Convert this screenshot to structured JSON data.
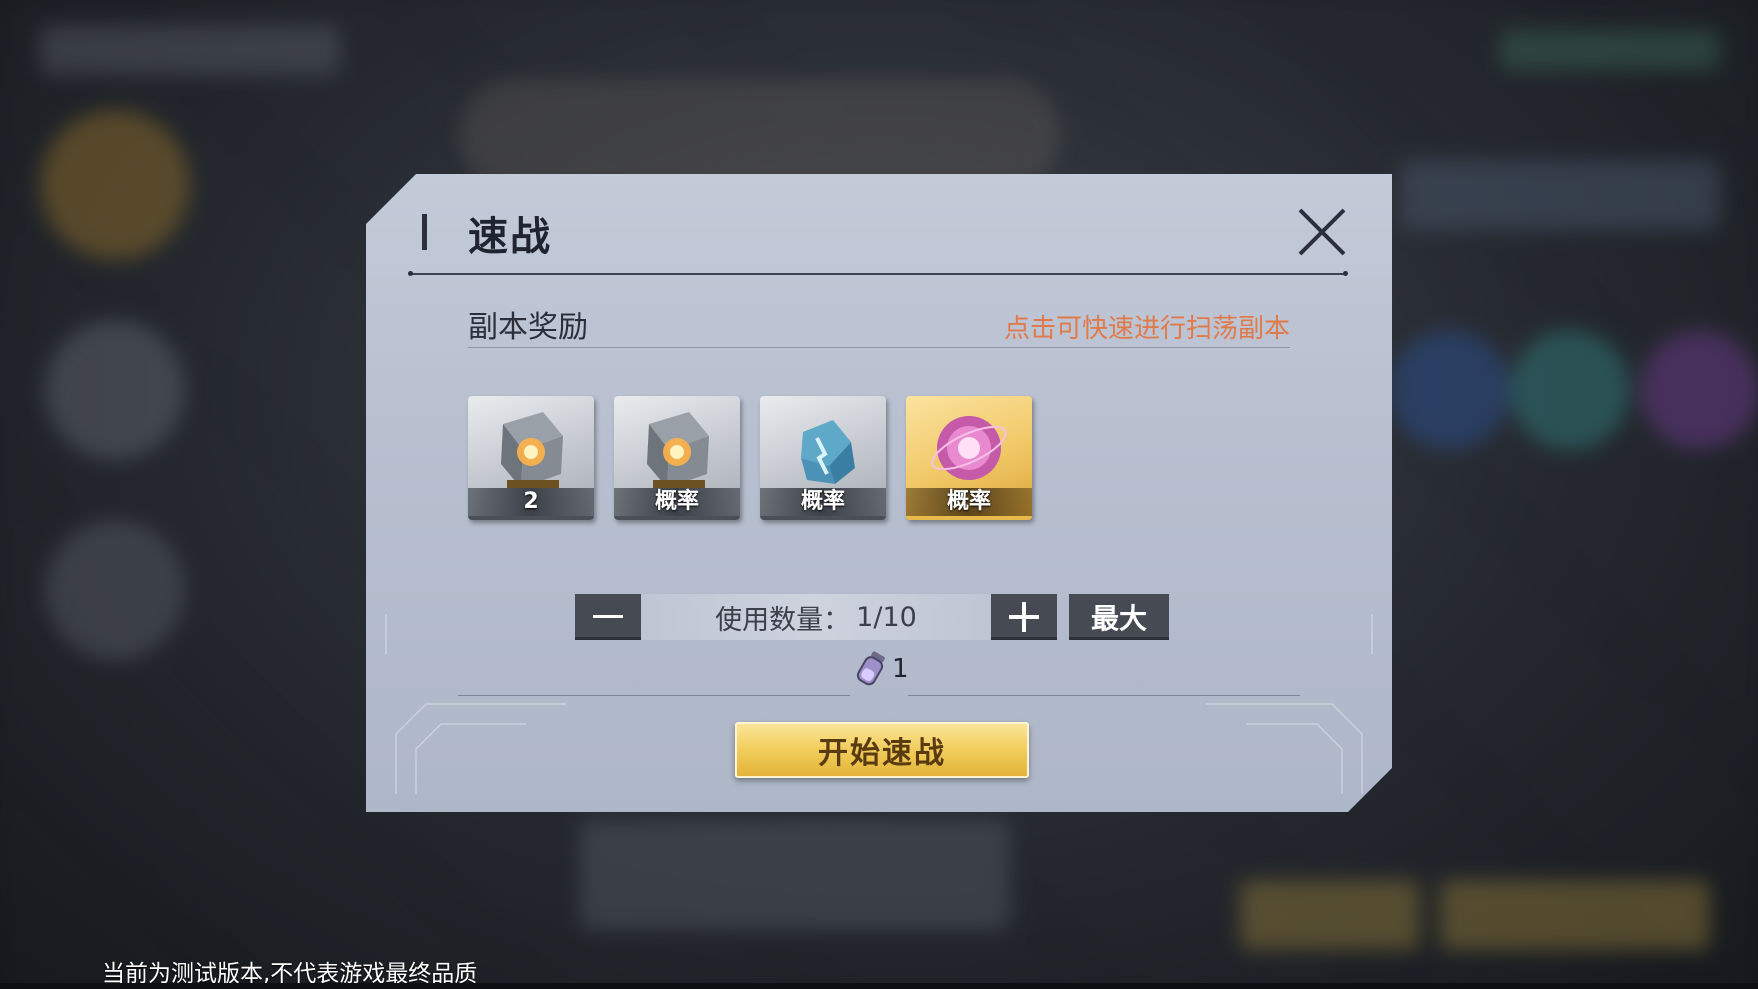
{
  "dialog": {
    "title": "速战",
    "reward_section_title": "副本奖励",
    "reward_hint": "点击可快速进行扫荡副本",
    "rewards": [
      {
        "label": "2",
        "icon": "ember-cube-icon"
      },
      {
        "label": "概率",
        "icon": "ember-cube-icon"
      },
      {
        "label": "概率",
        "icon": "blue-crystal-icon"
      },
      {
        "label": "概率",
        "icon": "pink-orb-icon"
      }
    ],
    "quantity": {
      "label": "使用数量：",
      "value": "1/10",
      "max_label": "最大"
    },
    "cost": {
      "icon": "stamina-vial-icon",
      "amount": "1"
    },
    "start_label": "开始速战"
  },
  "footer": {
    "notice": "当前为测试版本,不代表游戏最终品质"
  },
  "colors": {
    "hint": "#e07a4b",
    "button_gold": "#f3cf5f",
    "dialog_bg": "#b8c0d0",
    "dark_button": "#454a53"
  }
}
